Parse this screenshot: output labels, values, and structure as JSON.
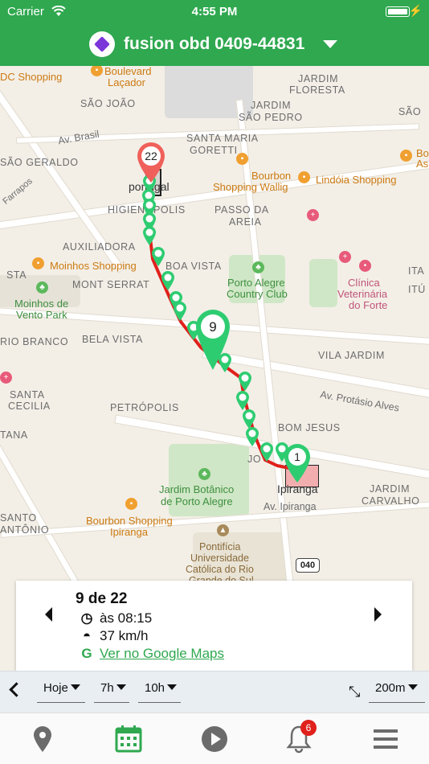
{
  "status_bar": {
    "carrier": "Carrier",
    "time": "4:55 PM"
  },
  "header": {
    "title": "fusion obd 0409-44831"
  },
  "map": {
    "labels": {
      "sao_joao": "SÃO JOÃO",
      "jardim_floresta_1": "JARDIM",
      "jardim_floresta_2": "FLORESTA",
      "jardim_sao_pedro_1": "JARDIM",
      "jardim_sao_pedro_2": "SÃO PEDRO",
      "sao_1": "SÃO",
      "av_brasil": "Av. Brasil",
      "sao_geraldo": "SÃO GERALDO",
      "santa_maria_1": "SANTA MARIA",
      "santa_maria_2": "GORETTI",
      "higienopolis": "HIGIENÓPOLIS",
      "passo_da_areia_1": "PASSO DA",
      "passo_da_areia_2": "AREIA",
      "auxiliadora": "AUXILIADORA",
      "mont_serrat": "MONT SERRAT",
      "boa_vista": "BOA VISTA",
      "rio_branco": "RIO BRANCO",
      "bela_vista": "BELA VISTA",
      "vila_jardim": "VILA JARDIM",
      "santa_cecilia_1": "SANTA",
      "santa_cecilia_2": "CECILIA",
      "petropolis": "PETRÓPOLIS",
      "bom_jesus": "BOM JESUS",
      "jardim_carvalho_1": "JARDIM",
      "jardim_carvalho_2": "CARVALHO",
      "santo_antonio_1": "SANTO",
      "santo_antonio_2": "ANTÔNIO",
      "av_protasio": "Av. Protásio Alves",
      "av_ipiranga": "Av. Ipiranga",
      "dc_shopping": "DC Shopping",
      "boulevard_1": "Boulevard",
      "boulevard_2": "Laçador",
      "bourbon_wallig_1": "Bourbon",
      "bourbon_wallig_2": "Shopping Wallig",
      "lindoia": "Lindóia Shopping",
      "moinhos_shopping": "Moinhos Shopping",
      "moinhos_park_1": "Moinhos de",
      "moinhos_park_2": "Vento Park",
      "country_club_1": "Porto Alegre",
      "country_club_2": "Country Club",
      "clinica_1": "Clínica",
      "clinica_2": "Veterinária",
      "clinica_3": "do Forte",
      "jardim_botanico_1": "Jardim Botânico",
      "jardim_botanico_2": "de Porto Alegre",
      "bourbon_ipiranga_1": "Bourbon Shopping",
      "bourbon_ipiranga_2": "Ipiranga",
      "pucrs_1": "Pontifícia",
      "pucrs_2": "Universidade",
      "pucrs_3": "Católica do Rio",
      "pucrs_4": "Grande do Sul",
      "portugal": "portugal",
      "ipiranga": "Ipiranga",
      "route_040": "040",
      "bo_a": "Bo",
      "bo_b": "As",
      "ita": "ITA",
      "ita2": "ITÚ",
      "sta": "STA",
      "tana": "TANA",
      "farrapos": "Farrapos",
      "jo": "JO"
    },
    "pins": {
      "start": "1",
      "current": "9",
      "end": "22"
    },
    "colors": {
      "route": "#e0201b",
      "pin_green": "#2ecc71",
      "pin_red": "#f0605a"
    }
  },
  "info_card": {
    "position_text": "9 de 22",
    "time_text": "às 08:15",
    "speed_text": "37 km/h",
    "google_glyph": "G",
    "google_maps_link": "Ver no Google Maps"
  },
  "filters": {
    "day": "Hoje",
    "start_hour": "7h",
    "end_hour": "10h",
    "distance": "200m"
  },
  "tabbar": {
    "notification_count": "6"
  }
}
